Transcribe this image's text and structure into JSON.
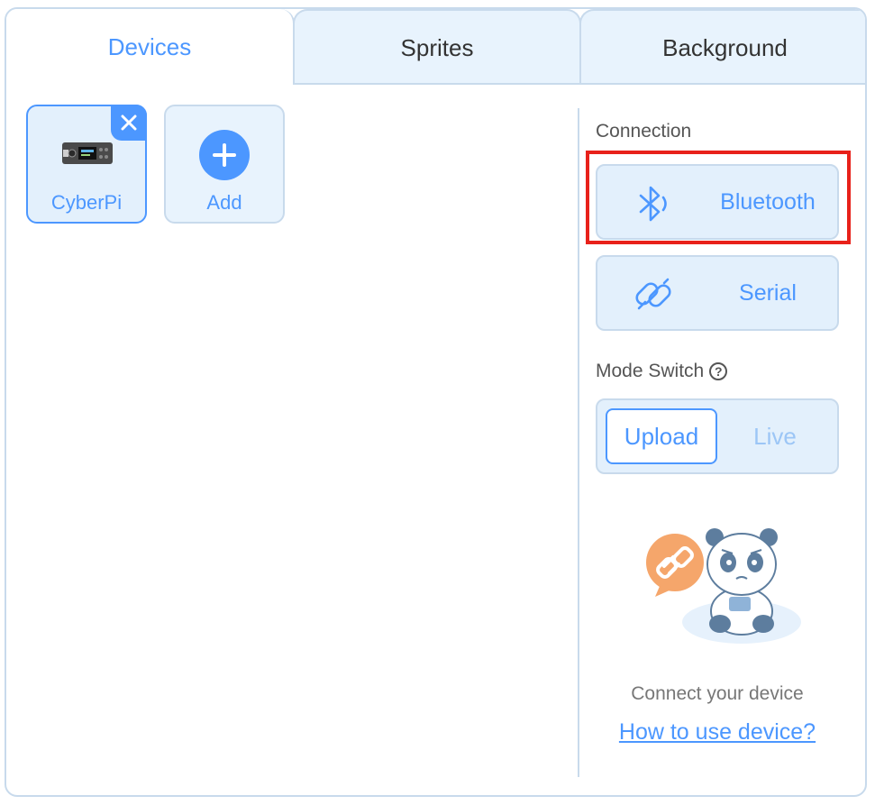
{
  "tabs": [
    {
      "label": "Devices",
      "active": true
    },
    {
      "label": "Sprites",
      "active": false
    },
    {
      "label": "Background",
      "active": false
    }
  ],
  "devices": [
    {
      "label": "CyberPi",
      "selected": true,
      "icon": "cyberpi-board-icon"
    },
    {
      "label": "Add",
      "icon": "plus-icon"
    }
  ],
  "connection": {
    "label": "Connection",
    "bluetooth_label": "Bluetooth",
    "serial_label": "Serial"
  },
  "mode_switch": {
    "label": "Mode Switch",
    "options": [
      "Upload",
      "Live"
    ],
    "selected": "Upload"
  },
  "footer": {
    "connect_text": "Connect your device",
    "howto_link": "How to use device?"
  },
  "colors": {
    "accent": "#4c97ff",
    "highlight": "#e8211a",
    "panel_bg": "#e3f0fc",
    "border": "#c8daec"
  }
}
